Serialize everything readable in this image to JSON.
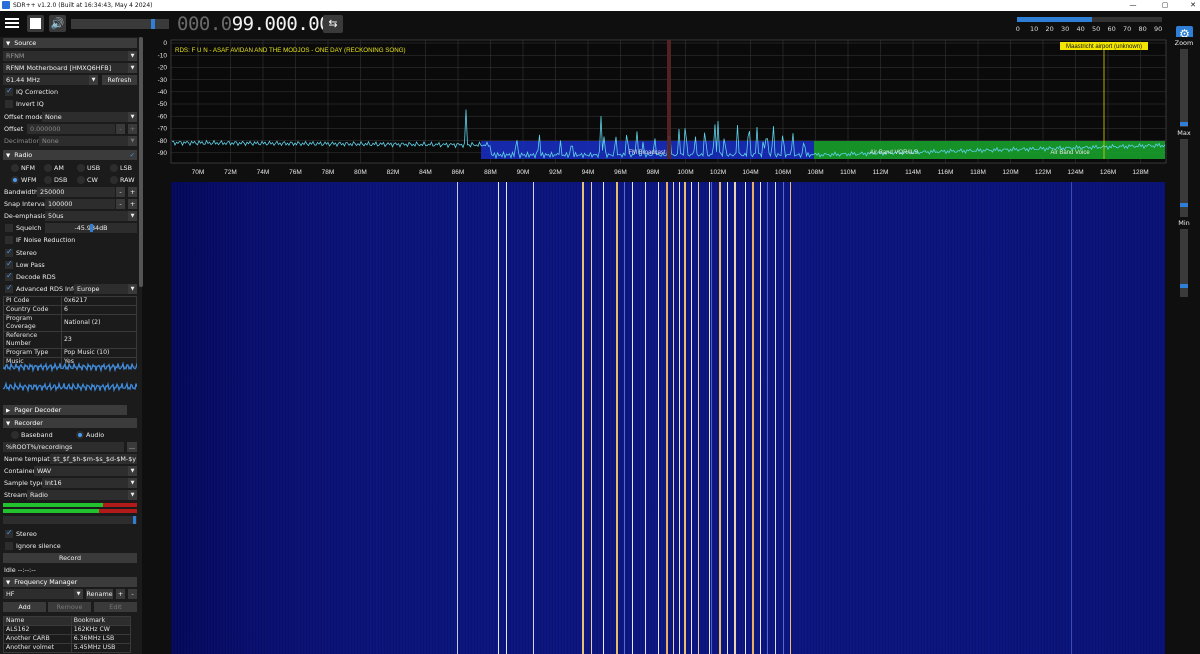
{
  "window": {
    "title": "SDR++ v1.2.0 (Built at 16:34:43, May  4 2024)",
    "minimize": "—",
    "maximize": "▢",
    "close": "✕"
  },
  "toolbar": {
    "frequency_dim": "000.0",
    "frequency_lit": "99.000.000",
    "volume_level": 0.85,
    "snr_ticks": [
      "0",
      "10",
      "20",
      "30",
      "40",
      "50",
      "60",
      "70",
      "80",
      "90"
    ],
    "snr_level": 0.52
  },
  "source": {
    "header": "Source",
    "type": "RFNM",
    "device": "RFNM Motherboard [HMXQ6HFB]",
    "samplerate": "61.44 MHz",
    "refresh": "Refresh",
    "iq_correction": "IQ Correction",
    "invert_iq": "Invert IQ",
    "offset_mode_label": "Offset mode",
    "offset_mode": "None",
    "offset_label": "Offset",
    "offset_value": "0.000000",
    "decimation_label": "Decimation",
    "decimation_value": "None",
    "minus": "-",
    "plus": "+"
  },
  "radio": {
    "header": "Radio",
    "modes": [
      "NFM",
      "AM",
      "USB",
      "LSB",
      "WFM",
      "DSB",
      "CW",
      "RAW"
    ],
    "selected_mode": "WFM",
    "bandwidth_label": "Bandwidth",
    "bandwidth": "250000",
    "snap_label": "Snap Interval",
    "snap": "100000",
    "deemph_label": "De-emphasis",
    "deemph": "50us",
    "squelch_label": "Squelch",
    "squelch_value": "-45.984dB",
    "if_nr": "IF Noise Reduction",
    "stereo": "Stereo",
    "lowpass": "Low Pass",
    "decode_rds": "Decode RDS",
    "adv_rds": "Advanced RDS Info",
    "region": "Europe"
  },
  "rds_info": [
    [
      "PI Code",
      "0x6217"
    ],
    [
      "Country Code",
      "6"
    ],
    [
      "Program Coverage",
      "National (2)"
    ],
    [
      "Reference Number",
      "23"
    ],
    [
      "Program Type",
      "Pop Music (10)"
    ],
    [
      "Music",
      "Yes"
    ]
  ],
  "pager": {
    "header": "Pager Decoder"
  },
  "recorder": {
    "header": "Recorder",
    "baseband": "Baseband",
    "audio": "Audio",
    "path": "%ROOT%/recordings",
    "browse": "...",
    "template_label": "Name template",
    "template": "$t_$f_$h-$m-$s_$d-$M-$y",
    "container_label": "Container",
    "container": "WAV",
    "sample_label": "Sample type",
    "sample": "Int16",
    "stream_label": "Stream",
    "stream": "Radio",
    "stereo": "Stereo",
    "ignore_silence": "Ignore silence",
    "record": "Record",
    "status": "Idle --:--:--"
  },
  "freqmgr": {
    "header": "Frequency Manager",
    "list": "HF",
    "rename": "Rename",
    "plus": "+",
    "minus": "-",
    "add": "Add",
    "remove": "Remove",
    "edit": "Edit",
    "columns": [
      "Name",
      "Bookmark"
    ],
    "rows": [
      [
        "ALS162",
        "162KHz CW"
      ],
      [
        "Another CARB",
        "6.36MHz LSB"
      ],
      [
        "Another volmet",
        "5.45MHz USB"
      ]
    ]
  },
  "fft": {
    "db_ticks": [
      "0",
      "-10",
      "-20",
      "-30",
      "-40",
      "-50",
      "-60",
      "-70",
      "-80",
      "-90"
    ],
    "freq_ticks": [
      "70M",
      "72M",
      "74M",
      "76M",
      "78M",
      "80M",
      "82M",
      "84M",
      "86M",
      "88M",
      "90M",
      "92M",
      "94M",
      "96M",
      "98M",
      "100M",
      "102M",
      "104M",
      "106M",
      "108M",
      "110M",
      "112M",
      "114M",
      "116M",
      "118M",
      "120M",
      "122M",
      "124M",
      "126M",
      "128M"
    ],
    "rds_text": "RDS:  F U N   - ASAF AVIDAN AND THE MODJOS - ONE DAY (RECKONING SONG)",
    "bands": [
      "FM Broadcast",
      "Air Band VOR/ILS",
      "Air Band Voice"
    ],
    "bookmark": "Maastricht airport (unknown)"
  },
  "rightpanel": {
    "zoom": "Zoom",
    "max": "Max",
    "min": "Min"
  },
  "colors": {
    "accent": "#2f7fd6",
    "fm_band": "#1a2fc8",
    "air_band": "#17a02a",
    "bookmark": "#f2e600",
    "waterfall": "#0c1580"
  }
}
